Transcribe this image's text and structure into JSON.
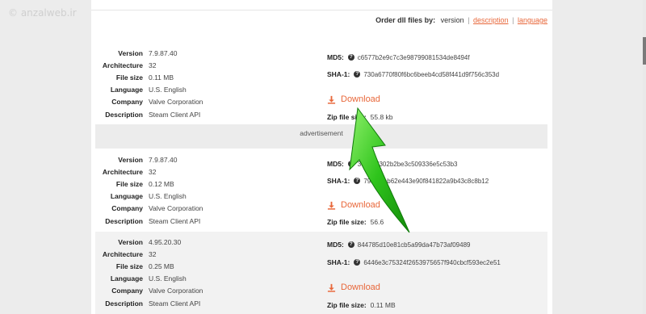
{
  "watermark": "© anzalweb.ir",
  "sort": {
    "label": "Order dll files by:",
    "current": "version",
    "options": [
      "description",
      "language"
    ]
  },
  "labels": {
    "version": "Version",
    "architecture": "Architecture",
    "file_size": "File size",
    "language": "Language",
    "company": "Company",
    "description": "Description",
    "md5": "MD5:",
    "sha1": "SHA-1:",
    "download": "Download",
    "zip_size": "Zip file size:"
  },
  "advertisement": "advertisement",
  "entries": [
    {
      "version": "7.9.87.40",
      "architecture": "32",
      "file_size": "0.11 MB",
      "language": "U.S. English",
      "company": "Valve Corporation",
      "description": "Steam Client API",
      "md5": "c6577b2e9c7c3e98799081534de8494f",
      "sha1": "730a6770f80f6bc6beeb4cd58f441d9f756c353d",
      "zip_size": "55.8 kb"
    },
    {
      "version": "7.9.87.40",
      "architecture": "32",
      "file_size": "0.12 MB",
      "language": "U.S. English",
      "company": "Valve Corporation",
      "description": "Steam Client API",
      "md5": "3334ed302b2be3c509336e5c53b3",
      "sha1": "7924feab62e443e90f841822a9b43c8c8b12",
      "zip_size": "56.6"
    },
    {
      "version": "4.95.20.30",
      "architecture": "32",
      "file_size": "0.25 MB",
      "language": "U.S. English",
      "company": "Valve Corporation",
      "description": "Steam Client API",
      "md5": "844785d10e81cb5a99da47b73af09489",
      "sha1": "6446e3c75324f2653975657f940cbcf593ec2e51",
      "zip_size": "0.11 MB"
    }
  ],
  "colors": {
    "accent": "#e8673a",
    "arrow": "#22b413"
  },
  "icons": {
    "download": "download-icon",
    "help": "question-circle-icon",
    "arrow": "green-arrow-icon"
  }
}
